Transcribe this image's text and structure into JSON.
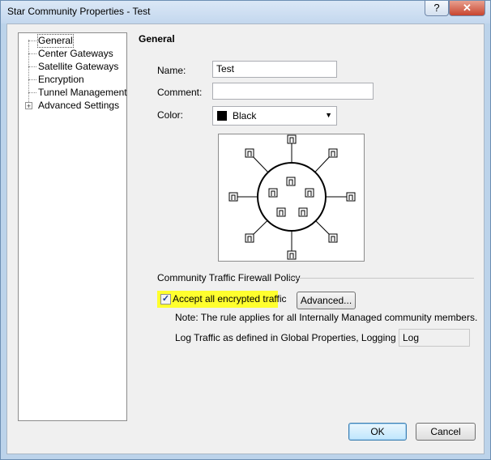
{
  "window": {
    "title": "Star Community Properties - Test",
    "help_label": "?",
    "close_label": "✕"
  },
  "tree": {
    "items": [
      {
        "label": "General",
        "selected": true
      },
      {
        "label": "Center Gateways"
      },
      {
        "label": "Satellite Gateways"
      },
      {
        "label": "Encryption"
      },
      {
        "label": "Tunnel Management"
      },
      {
        "label": "Advanced Settings",
        "expander": "+"
      }
    ]
  },
  "general": {
    "heading": "General",
    "name_label": "Name:",
    "name_value": "Test",
    "comment_label": "Comment:",
    "comment_value": "",
    "color_label": "Color:",
    "color_value": "Black",
    "color_swatch": "#000000",
    "preview_icon": "star-community-topology-icon"
  },
  "policy": {
    "section_title": "Community Traffic Firewall Policy",
    "accept_label": "Accept all encrypted traffic",
    "accept_checked": true,
    "check_mark": "✓",
    "highlight_color": "#ffff2e",
    "advanced_button": "Advanced...",
    "note": "Note: The rule applies for all Internally Managed community members.",
    "log_label": "Log Traffic as defined in Global Properties, Logging Tab:",
    "log_value": "Log"
  },
  "footer": {
    "ok": "OK",
    "cancel": "Cancel"
  }
}
